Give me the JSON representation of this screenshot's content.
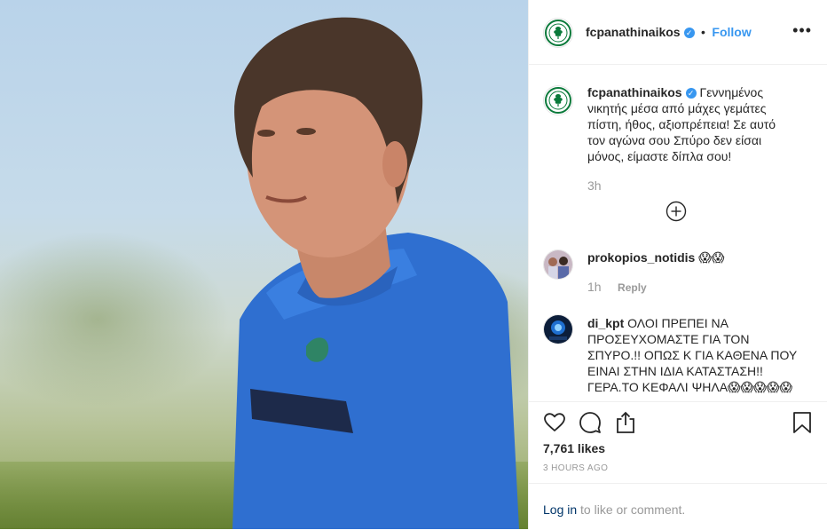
{
  "post": {
    "account": "fcpanathinaikos",
    "follow_label": "Follow",
    "separator": "•",
    "more_icon": "more-dots-icon"
  },
  "caption": {
    "account": "fcpanathinaikos",
    "text": "Γεννημένος νικητής μέσα από μάχες γεμάτες πίστη, ήθος, αξιοπρέπεια! Σε αυτό τον αγώνα σου Σπύρο δεν είσαι μόνος, είμαστε δίπλα σου!",
    "age": "3h"
  },
  "comments": [
    {
      "user": "prokopios_notidis",
      "text": "😱😱",
      "age": "1h",
      "reply_label": "Reply"
    },
    {
      "user": "di_kpt",
      "text": "ΟΛΟΙ ΠΡΕΠΕΙ ΝΑ ΠΡΟΣΕΥΧΟΜΑΣΤΕ ΓΙΑ ΤΟΝ ΣΠΥΡΟ.!! ΟΠΩΣ Κ ΓΙΑ ΚΑΘΕΝΑ ΠΟΥ ΕΙΝΑΙ ΣΤΗΝ ΙΔΙΑ ΚΑΤΑΣΤΑΣΗ!!ΓΕΡΑ.ΤΟ ΚΕΦΑΛΙ ΨΗΛΑ😱😱😱😱😱"
    }
  ],
  "stats": {
    "likes": "7,761 likes",
    "posted": "3 HOURS AGO"
  },
  "login": {
    "link": "Log in",
    "rest": " to like or comment."
  },
  "colors": {
    "link_blue": "#3897f0",
    "border": "#efefef",
    "muted": "#999999"
  }
}
